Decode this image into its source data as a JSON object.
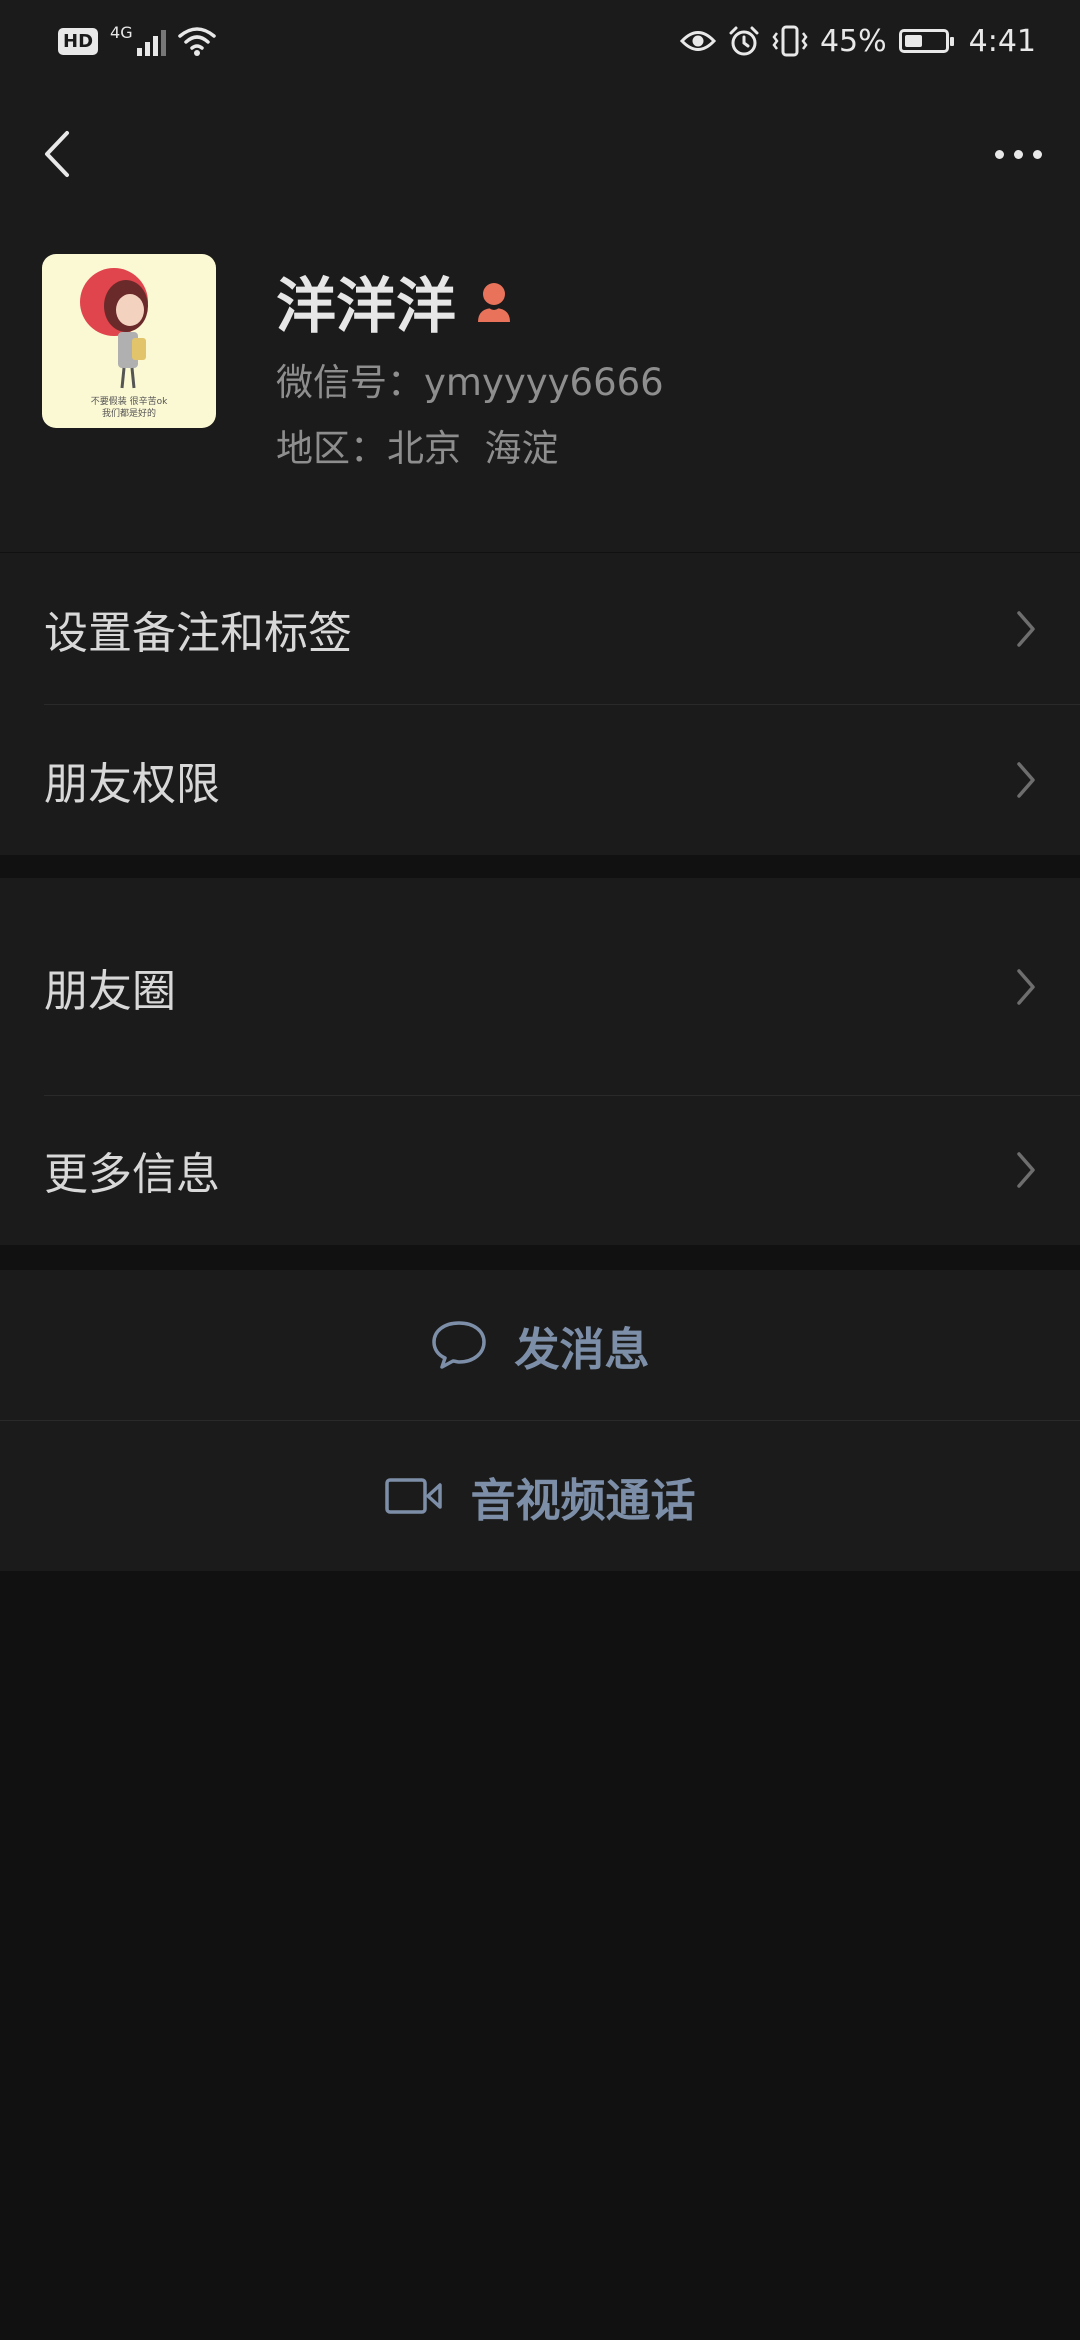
{
  "status_bar": {
    "hd": "HD",
    "network": "4G",
    "battery_text": "45%",
    "battery_level": 0.45,
    "time": "4:41"
  },
  "nav": {
    "back_icon": "chevron-left-icon",
    "more_icon": "more-dots-icon"
  },
  "profile": {
    "name": "洋洋洋",
    "gender_icon": "female-icon",
    "gender_color": "#e8735a",
    "wechat_id": "微信号：ymyyyy6666",
    "region": "地区：北京  海淀",
    "avatar_caption_1": "不要假装 很辛苦ok",
    "avatar_caption_2": "我们都是好的"
  },
  "menu_group_1": [
    {
      "label": "设置备注和标签"
    },
    {
      "label": "朋友权限"
    }
  ],
  "menu_group_2": [
    {
      "label": "朋友圈"
    },
    {
      "label": "更多信息"
    }
  ],
  "actions": {
    "send_message": "发消息",
    "av_call": "音视频通话",
    "accent_color": "#7d8fa8"
  }
}
